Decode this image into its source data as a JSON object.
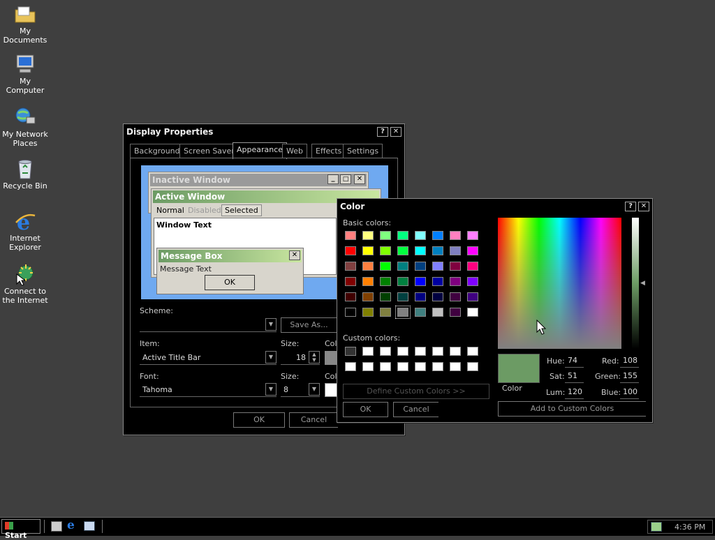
{
  "desktop_icons": [
    {
      "label": "My Documents",
      "icon": "my-documents-icon"
    },
    {
      "label": "My Computer",
      "icon": "my-computer-icon"
    },
    {
      "label": "My Network Places",
      "icon": "network-places-icon"
    },
    {
      "label": "Recycle Bin",
      "icon": "recycle-bin-icon"
    },
    {
      "label": "Internet Explorer",
      "icon": "internet-explorer-icon"
    },
    {
      "label": "Connect to the Internet",
      "icon": "connect-internet-icon"
    }
  ],
  "display_properties": {
    "title": "Display Properties",
    "tabs": [
      "Background",
      "Screen Saver",
      "Appearance",
      "Web",
      "Effects",
      "Settings"
    ],
    "preview": {
      "inactive_title": "Inactive Window",
      "active_title": "Active Window",
      "menu_items": [
        "Normal",
        "Disabled",
        "Selected"
      ],
      "window_text": "Window Text",
      "message_title": "Message Box",
      "message_text": "Message Text",
      "message_ok": "OK"
    },
    "scheme_label": "Scheme:",
    "scheme_value": "",
    "save_as": "Save As...",
    "item_label": "Item:",
    "item_value": "Active Title Bar",
    "size_label": "Size:",
    "item_size": "18",
    "color_label": "Colo",
    "font_label": "Font:",
    "font_value": "Tahoma",
    "font_size_label": "Size:",
    "font_size": "8",
    "font_color_label": "Colo",
    "ok": "OK",
    "cancel": "Cancel"
  },
  "color_dialog": {
    "title": "Color",
    "basic_colors_label": "Basic colors:",
    "custom_colors_label": "Custom colors:",
    "define_custom": "Define Custom Colors >>",
    "ok": "OK",
    "cancel": "Cancel",
    "color_solid_label": "Color",
    "hue_label": "Hue:",
    "hue": "74",
    "sat_label": "Sat:",
    "sat": "51",
    "lum_label": "Lum:",
    "lum": "120",
    "red_label": "Red:",
    "red": "108",
    "green_label": "Green:",
    "green": "155",
    "blue_label": "Blue:",
    "blue": "100",
    "add_custom": "Add to Custom Colors",
    "preview_color": "#6c9b64",
    "basic_colors": [
      "#ff8080",
      "#ffff80",
      "#80ff80",
      "#00ff80",
      "#80ffff",
      "#0080ff",
      "#ff80c0",
      "#ff80ff",
      "#ff0000",
      "#ffff00",
      "#80ff00",
      "#00ff40",
      "#00ffff",
      "#0080c0",
      "#8080c0",
      "#ff00ff",
      "#804040",
      "#ff8040",
      "#00ff00",
      "#008080",
      "#004080",
      "#8080ff",
      "#800040",
      "#ff0080",
      "#800000",
      "#ff8000",
      "#008000",
      "#008040",
      "#0000ff",
      "#0000a0",
      "#800080",
      "#8000ff",
      "#400000",
      "#804000",
      "#004000",
      "#004040",
      "#000080",
      "#000040",
      "#400040",
      "#400080",
      "#000000",
      "#808000",
      "#808040",
      "#808080",
      "#408080",
      "#c0c0c0",
      "#400040",
      "#ffffff"
    ],
    "custom_colors": [
      "#333333",
      "#ffffff",
      "#ffffff",
      "#ffffff",
      "#ffffff",
      "#ffffff",
      "#ffffff",
      "#ffffff",
      "#ffffff",
      "#ffffff",
      "#ffffff",
      "#ffffff",
      "#ffffff",
      "#ffffff",
      "#ffffff",
      "#ffffff"
    ]
  },
  "taskbar": {
    "start": "Start",
    "quick_launch": [
      "show-desktop-icon",
      "internet-explorer-icon",
      "outlook-express-icon"
    ],
    "clock": "4:36 PM"
  }
}
